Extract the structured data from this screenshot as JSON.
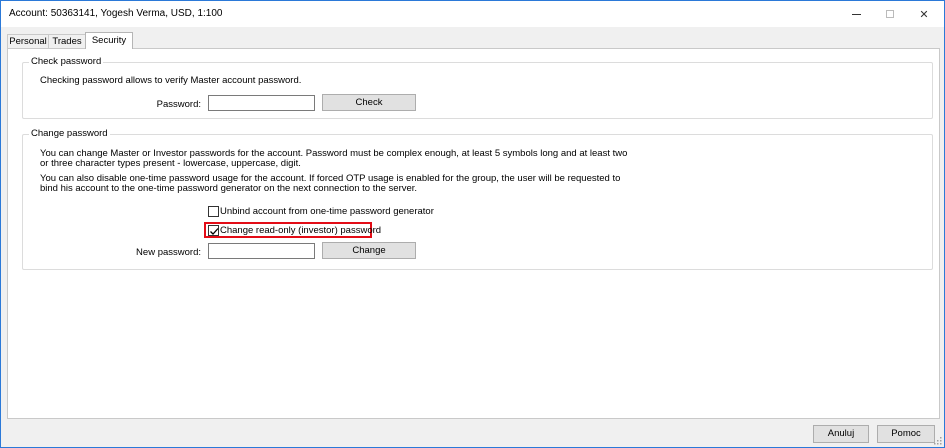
{
  "window": {
    "title": "Account: 50363141, Yogesh Verma, USD, 1:100",
    "controls": {
      "minimize": "minimize",
      "maximize": "maximize",
      "close": "✕"
    }
  },
  "tabs": [
    {
      "label": "Personal",
      "active": false
    },
    {
      "label": "Trades",
      "active": false
    },
    {
      "label": "Security",
      "active": true
    }
  ],
  "check_password": {
    "legend": "Check password",
    "description": "Checking password allows to verify Master account password.",
    "password_label": "Password:",
    "password_value": "",
    "button_label": "Check"
  },
  "change_password": {
    "legend": "Change password",
    "description_line1": "You can change Master or Investor passwords for the account. Password must be complex enough, at least 5 symbols long and at least two",
    "description_line2": "or three character types present - lowercase, uppercase, digit.",
    "otp_line1": "You can also disable one-time password usage for the account. If forced OTP usage is enabled for the group, the user will be requested to",
    "otp_line2": "bind his account to the one-time password generator on the next connection to the server.",
    "unbind_label": "Unbind account from one-time password generator",
    "unbind_checked": false,
    "investor_label": "Change read-only (investor) password",
    "investor_checked": true,
    "new_password_label": "New password:",
    "new_password_value": "",
    "button_label": "Change"
  },
  "footer": {
    "cancel_label": "Anuluj",
    "help_label": "Pomoc"
  },
  "colors": {
    "highlight": "#e30c16",
    "window_border": "#2b79d8",
    "button_face": "#e1e1e1"
  }
}
